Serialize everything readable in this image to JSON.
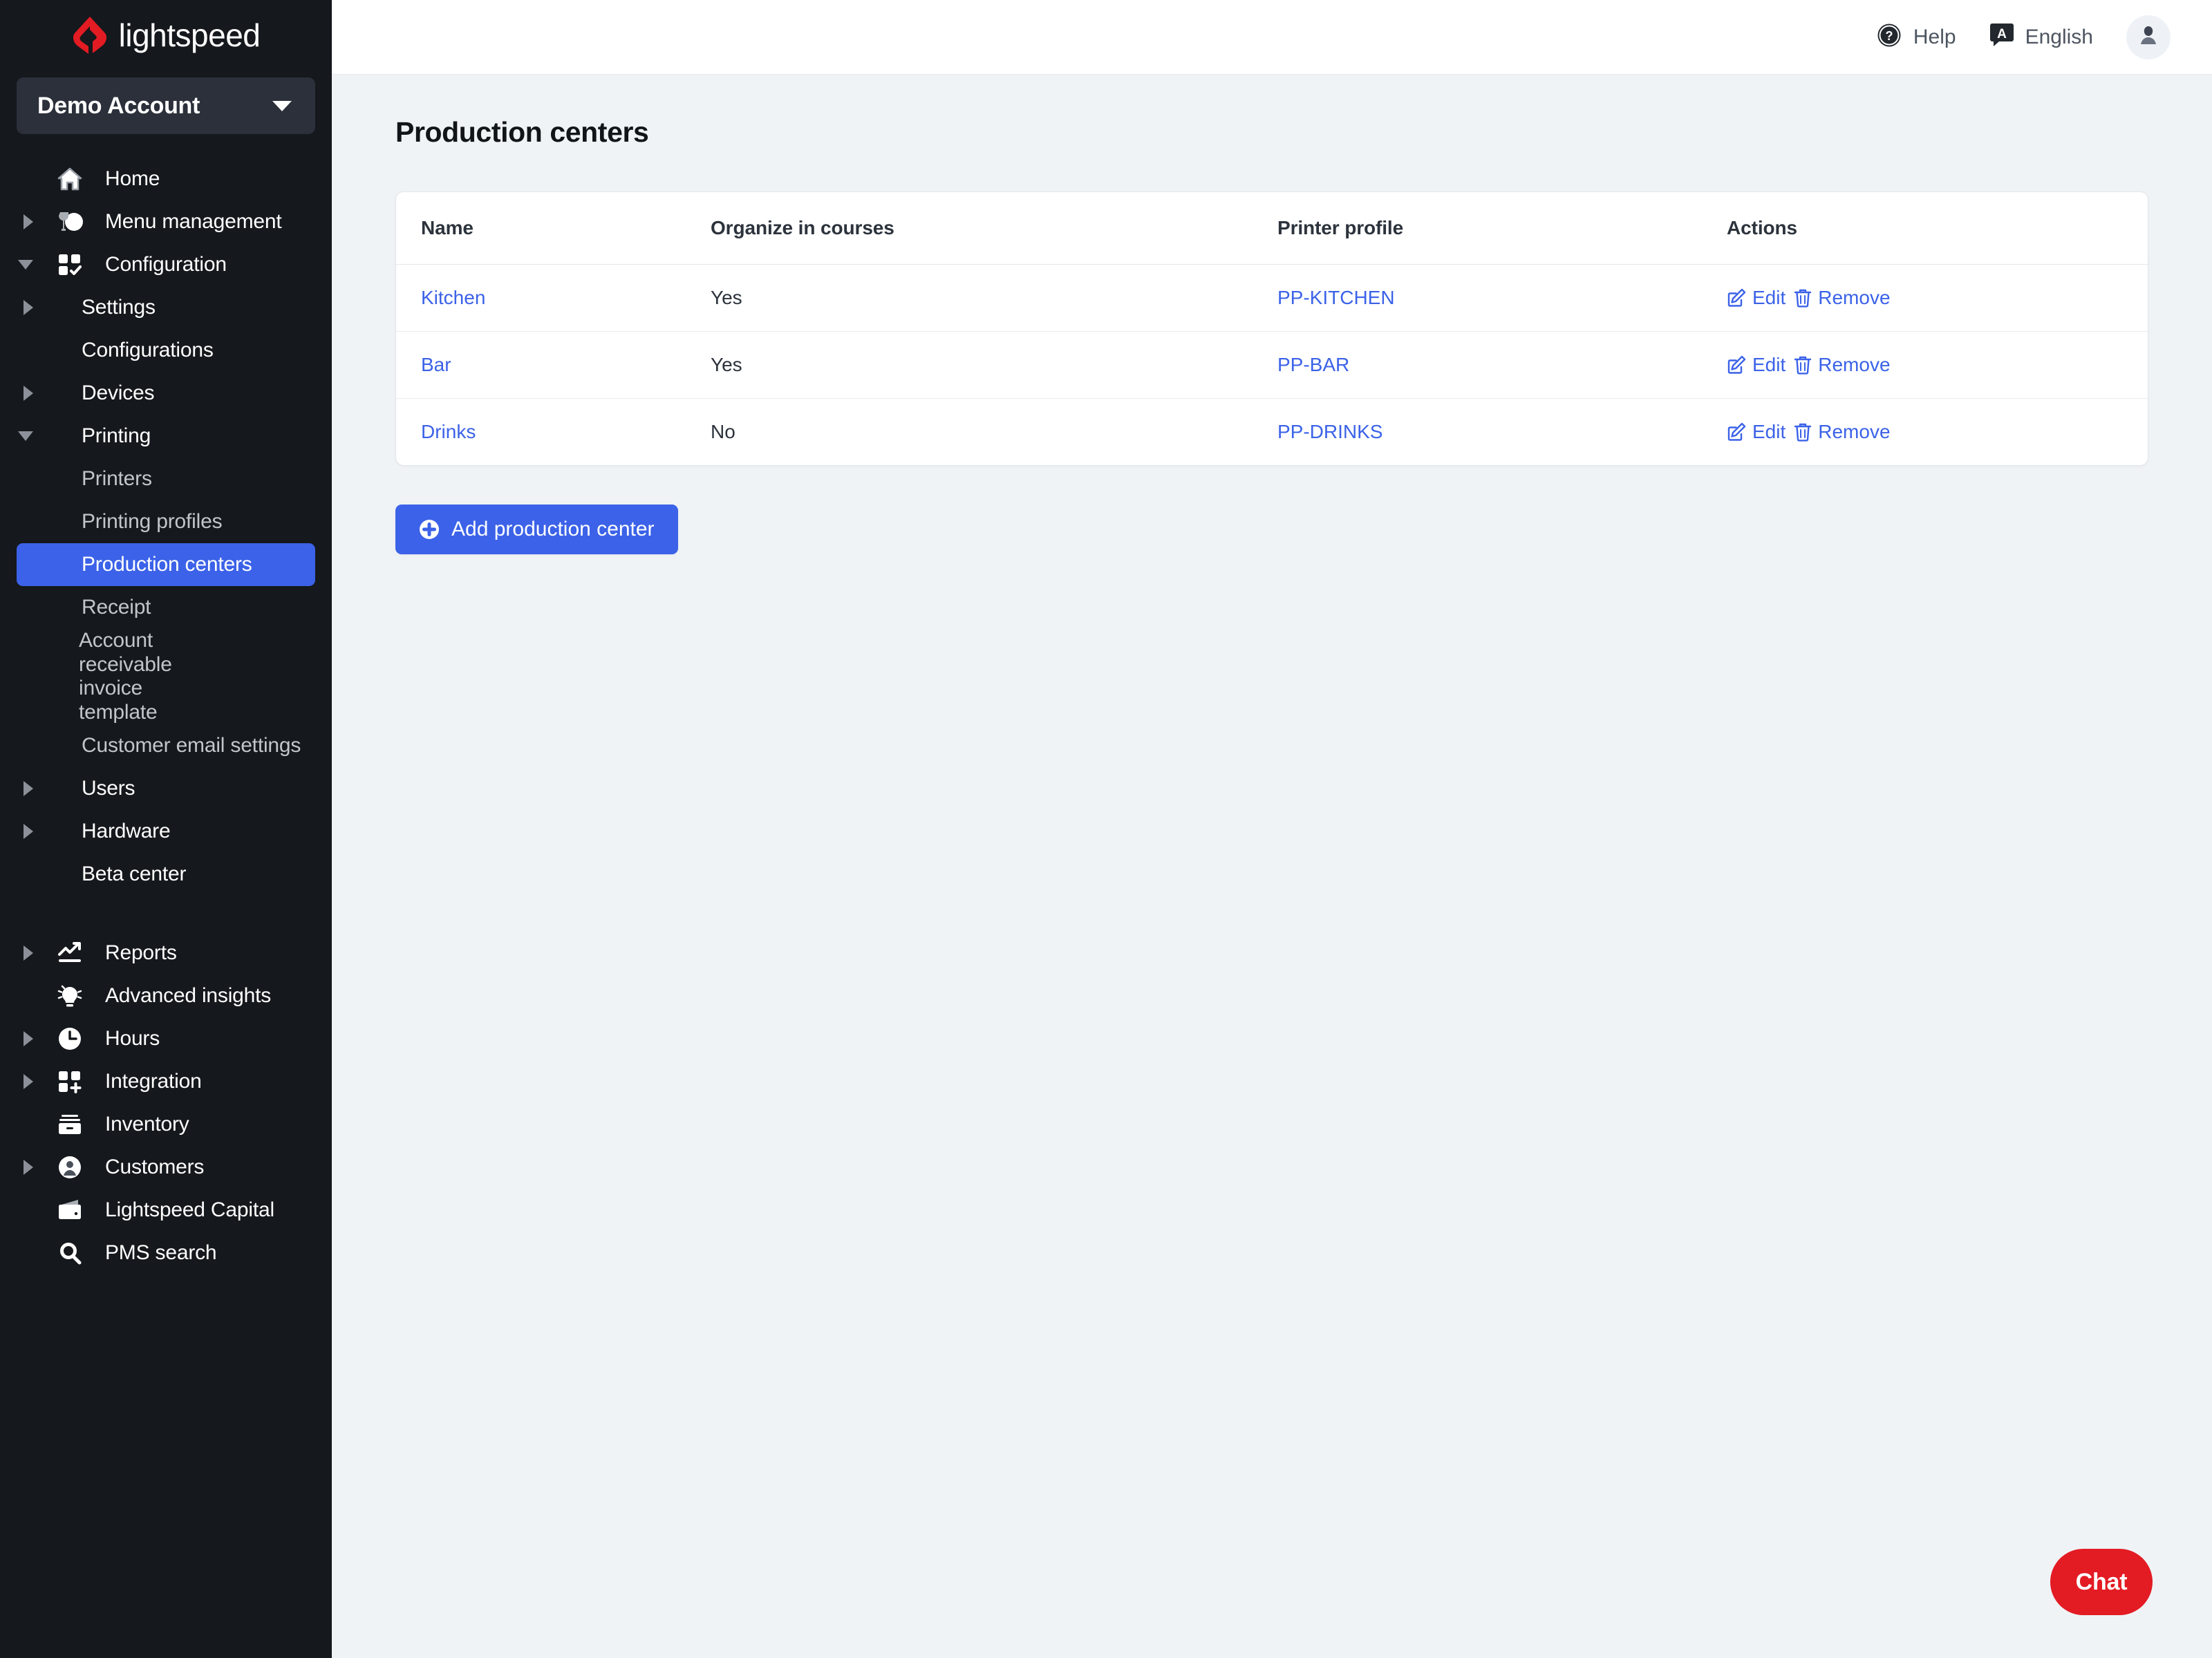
{
  "brand": {
    "name": "lightspeed",
    "logo_icon": "lightspeed-flame-logo",
    "accent": "#e31b23"
  },
  "sidebar": {
    "account": {
      "label": "Demo Account",
      "caret_icon": "chevron-down-icon"
    },
    "items": [
      {
        "label": "Home",
        "level": 1,
        "icon": "home-icon",
        "arrow": "none"
      },
      {
        "label": "Menu management",
        "level": 1,
        "icon": "menu-mgmt-icon",
        "arrow": "right"
      },
      {
        "label": "Configuration",
        "level": 1,
        "icon": "grid-check-icon",
        "arrow": "down"
      },
      {
        "label": "Settings",
        "level": 2,
        "icon": "none",
        "arrow": "right"
      },
      {
        "label": "Configurations",
        "level": 2,
        "icon": "none",
        "arrow": "none"
      },
      {
        "label": "Devices",
        "level": 2,
        "icon": "none",
        "arrow": "right"
      },
      {
        "label": "Printing",
        "level": 2,
        "icon": "none",
        "arrow": "down"
      },
      {
        "label": "Printers",
        "level": 3,
        "icon": "none",
        "arrow": "none"
      },
      {
        "label": "Printing profiles",
        "level": 3,
        "icon": "none",
        "arrow": "none"
      },
      {
        "label": "Production centers",
        "level": 3,
        "icon": "none",
        "arrow": "none",
        "active": true
      },
      {
        "label": "Receipt",
        "level": 3,
        "icon": "none",
        "arrow": "none"
      },
      {
        "label": "Account receivable invoice template",
        "level": 3,
        "icon": "none",
        "arrow": "none",
        "multiline": true
      },
      {
        "label": "Customer email settings",
        "level": 3,
        "icon": "none",
        "arrow": "none"
      },
      {
        "label": "Users",
        "level": 2,
        "icon": "none",
        "arrow": "right"
      },
      {
        "label": "Hardware",
        "level": 2,
        "icon": "none",
        "arrow": "right"
      },
      {
        "label": "Beta center",
        "level": 2,
        "icon": "none",
        "arrow": "none"
      },
      {
        "label": "Reports",
        "level": 1,
        "icon": "chart-line-icon",
        "arrow": "right",
        "spacer_before": true
      },
      {
        "label": "Advanced insights",
        "level": 1,
        "icon": "lightbulb-icon",
        "arrow": "none"
      },
      {
        "label": "Hours",
        "level": 1,
        "icon": "clock-icon",
        "arrow": "right"
      },
      {
        "label": "Integration",
        "level": 1,
        "icon": "grid-plus-icon",
        "arrow": "right"
      },
      {
        "label": "Inventory",
        "level": 1,
        "icon": "inventory-icon",
        "arrow": "none"
      },
      {
        "label": "Customers",
        "level": 1,
        "icon": "user-circle-icon",
        "arrow": "right"
      },
      {
        "label": "Lightspeed Capital",
        "level": 1,
        "icon": "wallet-icon",
        "arrow": "none"
      },
      {
        "label": "PMS search",
        "level": 1,
        "icon": "search-icon",
        "arrow": "none"
      }
    ],
    "active_item": "Production centers",
    "active_color": "#3b62e8"
  },
  "topbar": {
    "help": {
      "label": "Help",
      "icon": "question-circle-icon"
    },
    "language": {
      "label": "English",
      "icon": "translate-badge-icon"
    },
    "avatar": {
      "icon": "user-avatar-icon"
    }
  },
  "main": {
    "page_title": "Production centers",
    "table": {
      "columns": [
        "Name",
        "Organize in courses",
        "Printer profile",
        "Actions"
      ],
      "rows": [
        {
          "name": "Kitchen",
          "organize_in_courses": "Yes",
          "printer_profile": "PP-KITCHEN",
          "edit": "Edit",
          "remove": "Remove"
        },
        {
          "name": "Bar",
          "organize_in_courses": "Yes",
          "printer_profile": "PP-BAR",
          "edit": "Edit",
          "remove": "Remove"
        },
        {
          "name": "Drinks",
          "organize_in_courses": "No",
          "printer_profile": "PP-DRINKS",
          "edit": "Edit",
          "remove": "Remove"
        }
      ],
      "link_color": "#3b62e8"
    },
    "add_button": {
      "label": "Add production center",
      "icon": "plus-circle-icon",
      "color": "#3b62e8"
    },
    "chat_button": {
      "label": "Chat",
      "color": "#e31b23"
    }
  }
}
